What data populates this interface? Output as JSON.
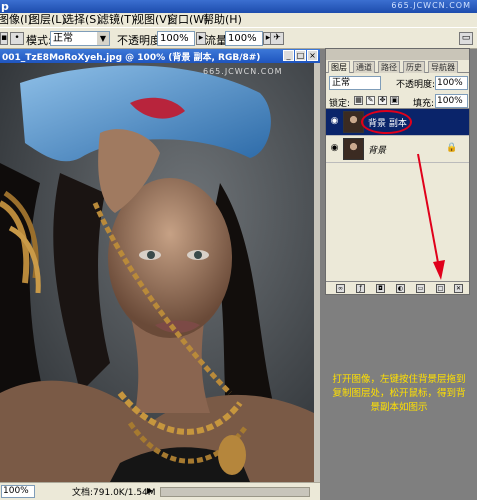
{
  "app_title": "p",
  "watermarks": {
    "top": "665.JCWCN.COM",
    "document": "665.JCWCN.COM"
  },
  "menu": {
    "items": [
      "图像(I)",
      "图层(L)",
      "选择(S)",
      "滤镜(T)",
      "视图(V)",
      "窗口(W)",
      "帮助(H)"
    ]
  },
  "options": {
    "mode_label": "模式:",
    "mode_value": "正常",
    "opacity_label": "不透明度:",
    "opacity_value": "100%",
    "flow_label": "流量:",
    "flow_value": "100%"
  },
  "document": {
    "title": "001_TzE8MoRoXyeh.jpg @ 100% (背景 副本, RGB/8#)",
    "zoom": "100%",
    "info": "文档:791.0K/1.54M"
  },
  "layers_panel": {
    "tabs": [
      "图层",
      "通道",
      "路径",
      "历史",
      "导航器"
    ],
    "blend_mode": "正常",
    "opacity_label": "不透明度:",
    "opacity_value": "100%",
    "lock_label": "锁定:",
    "fill_label": "填充:",
    "fill_value": "100%",
    "layers": [
      {
        "name": "背景 副本",
        "selected": true
      },
      {
        "name": "背景",
        "selected": false,
        "locked": true
      }
    ]
  },
  "annotation": {
    "text": "打开图像，左键按住背景层拖到复制图层处，松开鼠标，得到背景副本如图示",
    "color": "#ffe000"
  },
  "colors": {
    "title_bar": "#1d4cad",
    "panel_bg": "#ece9d8",
    "selection": "#0a246a",
    "arrow": "#e0001b"
  }
}
